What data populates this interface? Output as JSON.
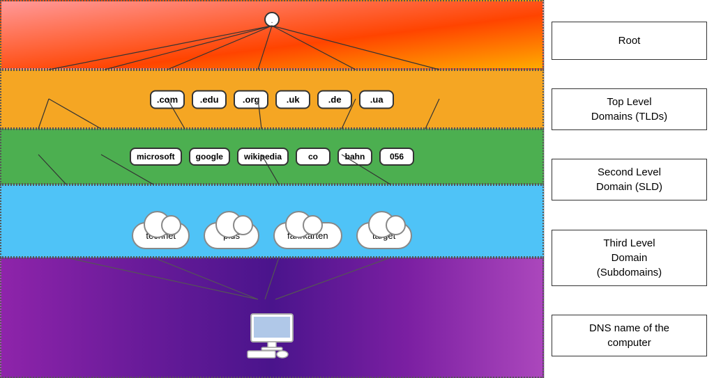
{
  "layers": {
    "root": {
      "label": "Root",
      "node_dot": "."
    },
    "tld": {
      "label": "Top Level Domains (TLDs)",
      "items": [
        ".com",
        ".edu",
        ".org",
        ".uk",
        ".de",
        ".ua"
      ]
    },
    "sld": {
      "label": "Second Level Domain (SLD)",
      "items": [
        "microsoft",
        "google",
        "wikipedia",
        "co",
        "bahn",
        "056"
      ]
    },
    "subdomain": {
      "label": "Third Level Domain (Subdomains)",
      "items": [
        "technet",
        "plus",
        "fahrkarten",
        "target"
      ]
    },
    "dns": {
      "label": "DNS name of the computer"
    }
  },
  "legend": {
    "items": [
      "Root",
      "Top Level\nDomains (TLDs)",
      "Second Level\nDomain (SLD)",
      "Third Level\nDomain\n(Subdomains)",
      "DNS name of the\ncomputer"
    ]
  }
}
